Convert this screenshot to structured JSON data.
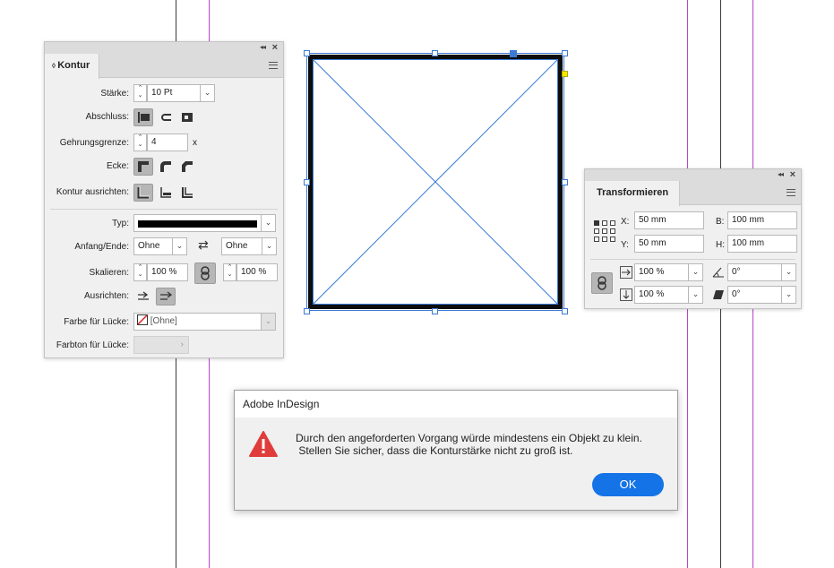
{
  "kontur_panel": {
    "tab_title": "Kontur",
    "staerke": {
      "label": "Stärke:",
      "value": "10 Pt"
    },
    "abschluss": {
      "label": "Abschluss:"
    },
    "gehrungsgrenze": {
      "label": "Gehrungsgrenze:",
      "value": "4",
      "unit": "x"
    },
    "ecke": {
      "label": "Ecke:"
    },
    "kontur_ausrichten": {
      "label": "Kontur ausrichten:"
    },
    "typ": {
      "label": "Typ:"
    },
    "anfang_ende": {
      "label": "Anfang/Ende:",
      "start": "Ohne",
      "end": "Ohne"
    },
    "skalieren": {
      "label": "Skalieren:",
      "start": "100 %",
      "end": "100 %"
    },
    "ausrichten": {
      "label": "Ausrichten:"
    },
    "farbe_luecke": {
      "label": "Farbe für Lücke:",
      "value": "[Ohne]"
    },
    "farbton_luecke": {
      "label": "Farbton für Lücke:"
    }
  },
  "transform_panel": {
    "tab_title": "Transformieren",
    "x": {
      "label": "X:",
      "value": "50 mm"
    },
    "y": {
      "label": "Y:",
      "value": "50 mm"
    },
    "b": {
      "label": "B:",
      "value": "100 mm"
    },
    "h": {
      "label": "H:",
      "value": "100 mm"
    },
    "scale_x": "100 %",
    "scale_y": "100 %",
    "rotation": "0°",
    "shear": "0°"
  },
  "dialog": {
    "title": "Adobe InDesign",
    "line1": "Durch den angeforderten Vorgang würde mindestens ein Objekt zu klein.",
    "line2": " Stellen Sie sicher, dass die Konturstärke nicht zu groß ist.",
    "ok_label": "OK",
    "icon": "warning-icon"
  },
  "colors": {
    "accent": "#1473e6",
    "frame_selection": "#3b7bd6",
    "margin_guide": "#b646c8",
    "warning": "#e03c3c"
  }
}
